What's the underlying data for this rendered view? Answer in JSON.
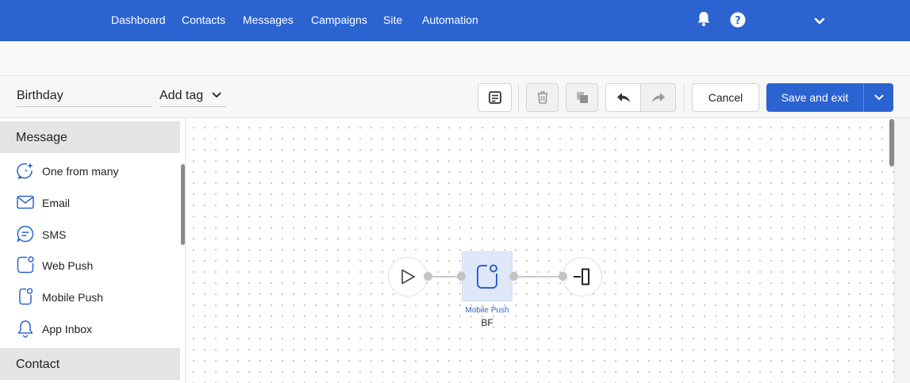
{
  "nav": {
    "items": [
      "Dashboard",
      "Contacts",
      "Messages",
      "Campaigns",
      "Site",
      "Automation"
    ],
    "icons": [
      "bell-icon",
      "help-icon",
      "chevron-down-icon"
    ],
    "color": "#2b63d0"
  },
  "toolbar": {
    "name_value": "Birthday",
    "tag_label": "Add tag",
    "cancel_label": "Cancel",
    "save_label": "Save and exit",
    "icons": [
      "note-icon",
      "trash-icon",
      "copy-icon",
      "undo-icon",
      "redo-icon"
    ]
  },
  "sidebar": {
    "sections": [
      {
        "title": "Message",
        "items": [
          {
            "label": "One from many",
            "icon": "sparkle-chat-icon"
          },
          {
            "label": "Email",
            "icon": "envelope-icon"
          },
          {
            "label": "SMS",
            "icon": "chat-bubble-icon"
          },
          {
            "label": "Web Push",
            "icon": "web-push-icon"
          },
          {
            "label": "Mobile Push",
            "icon": "mobile-push-icon"
          },
          {
            "label": "App Inbox",
            "icon": "bell-outline-icon"
          }
        ]
      },
      {
        "title": "Contact",
        "items": []
      }
    ]
  },
  "canvas": {
    "nodes": [
      {
        "type": "start",
        "icon": "play-icon"
      },
      {
        "type": "mobile-push",
        "icon": "mobile-push-icon",
        "label": "Mobile Push",
        "sublabel": "BF"
      },
      {
        "type": "exit",
        "icon": "exit-icon"
      }
    ]
  }
}
